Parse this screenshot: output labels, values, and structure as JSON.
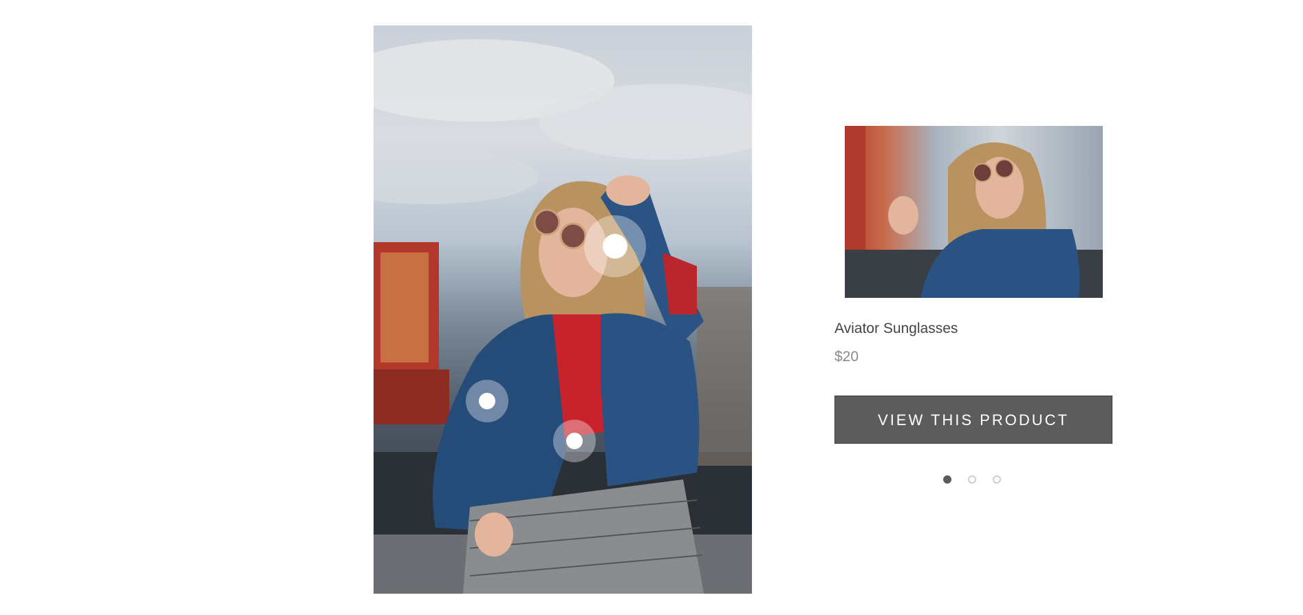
{
  "lookbook": {
    "image_alt": "Woman in denim jacket and aviator sunglasses at a fairground",
    "hotspots": [
      {
        "id": 1,
        "label": "sunglasses hotspot"
      },
      {
        "id": 2,
        "label": "jacket hotspot"
      },
      {
        "id": 3,
        "label": "top hotspot"
      }
    ]
  },
  "product": {
    "title": "Aviator Sunglasses",
    "price": "$20",
    "button_label": "VIEW THIS PRODUCT"
  },
  "pager": {
    "count": 3,
    "active_index": 0
  },
  "colors": {
    "button_bg": "#5c5c5c",
    "title_text": "#444444",
    "price_text": "#8a8a8a",
    "pager_active": "#5c5c5c",
    "pager_inactive": "#cfcfcf"
  }
}
